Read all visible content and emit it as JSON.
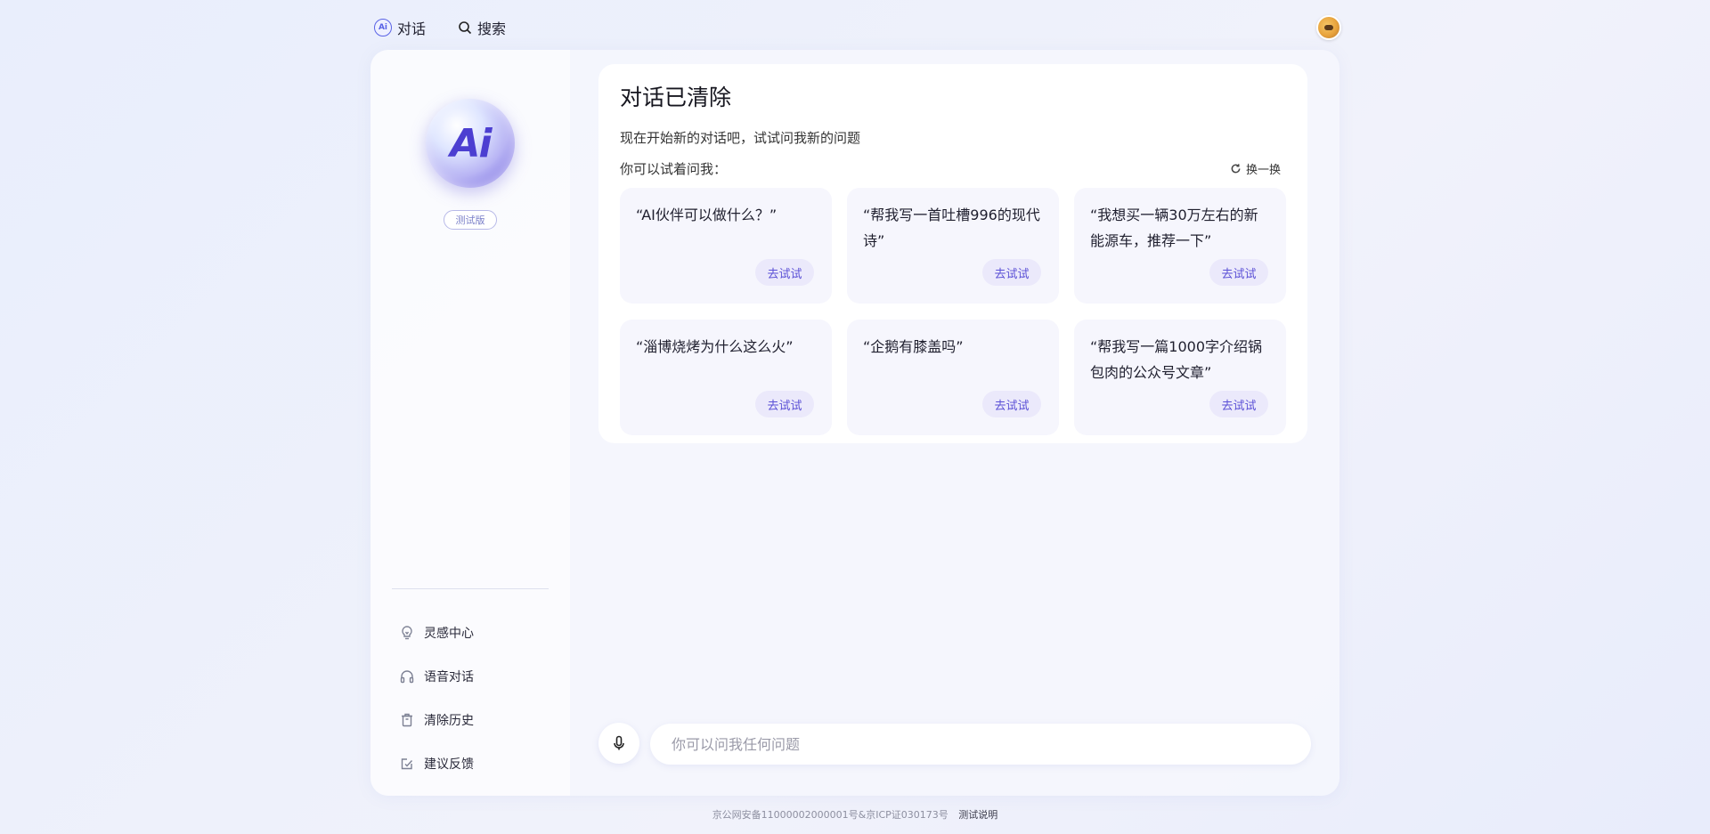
{
  "header": {
    "brand_logo_text": "Ai",
    "brand_title": "对话",
    "search_label": "搜索"
  },
  "sidebar": {
    "logo_text": "Ai",
    "badge": "测试版",
    "menu": [
      {
        "label": "灵感中心",
        "icon": "lightbulb-icon"
      },
      {
        "label": "语音对话",
        "icon": "headphones-icon"
      },
      {
        "label": "清除历史",
        "icon": "trash-icon"
      },
      {
        "label": "建议反馈",
        "icon": "feedback-icon"
      }
    ]
  },
  "welcome": {
    "title": "对话已清除",
    "subtitle": "现在开始新的对话吧，试试问我新的问题",
    "ask_label": "你可以试着问我：",
    "refresh_label": "换一换",
    "cards": [
      {
        "text": "“AI伙伴可以做什么？”",
        "button": "去试试"
      },
      {
        "text": "“帮我写一首吐槽996的现代诗”",
        "button": "去试试"
      },
      {
        "text": "“我想买一辆30万左右的新能源车，推荐一下”",
        "button": "去试试"
      },
      {
        "text": "“淄博烧烤为什么这么火”",
        "button": "去试试"
      },
      {
        "text": "“企鹅有膝盖吗”",
        "button": "去试试"
      },
      {
        "text": "“帮我写一篇1000字介绍锅包肉的公众号文章”",
        "button": "去试试"
      }
    ]
  },
  "input": {
    "placeholder": "你可以问我任何问题",
    "value": ""
  },
  "footer": {
    "icp_text": "京公网安备11000002000001号&京ICP证030173号",
    "link_text": "测试说明"
  },
  "colors": {
    "accent": "#5a4fd6",
    "card_bg": "#f6f6fd",
    "try_bg": "#ebe9fb"
  }
}
